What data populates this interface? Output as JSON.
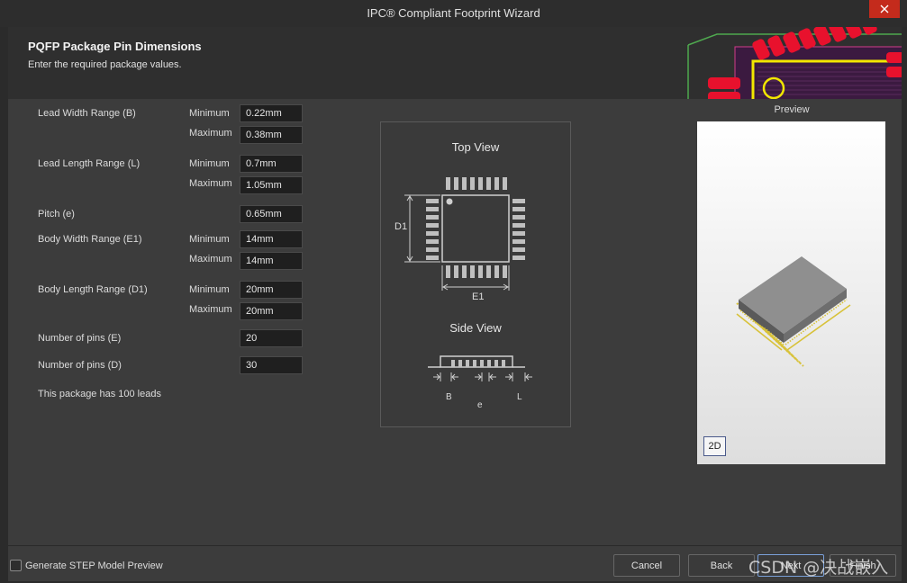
{
  "window": {
    "title": "IPC® Compliant Footprint Wizard"
  },
  "header": {
    "title": "PQFP Package Pin Dimensions",
    "subtitle": "Enter the required package values."
  },
  "form": {
    "lead_width": {
      "label": "Lead Width Range (B)",
      "min_label": "Minimum",
      "min": "0.22mm",
      "max_label": "Maximum",
      "max": "0.38mm"
    },
    "lead_length": {
      "label": "Lead Length Range (L)",
      "min_label": "Minimum",
      "min": "0.7mm",
      "max_label": "Maximum",
      "max": "1.05mm"
    },
    "pitch": {
      "label": "Pitch (e)",
      "value": "0.65mm"
    },
    "body_width": {
      "label": "Body Width Range (E1)",
      "min_label": "Minimum",
      "min": "14mm",
      "max_label": "Maximum",
      "max": "14mm"
    },
    "body_length": {
      "label": "Body Length Range (D1)",
      "min_label": "Minimum",
      "min": "20mm",
      "max_label": "Maximum",
      "max": "20mm"
    },
    "pins_e": {
      "label": "Number of pins (E)",
      "value": "20"
    },
    "pins_d": {
      "label": "Number of pins (D)",
      "value": "30"
    },
    "lead_count_text": "This package has 100 leads"
  },
  "diagram": {
    "top_view": "Top View",
    "side_view": "Side View",
    "d1": "D1",
    "e1": "E1",
    "b": "B",
    "e": "e",
    "l": "L"
  },
  "preview": {
    "label": "Preview",
    "mode_button": "2D"
  },
  "footer": {
    "step_checkbox_label": "Generate STEP Model Preview",
    "step_checked": false,
    "cancel": "Cancel",
    "back": "Back",
    "next": "Next",
    "finish": "Finish"
  },
  "watermark": "CSDN @决战嵌入式",
  "colors": {
    "accent": "#c42b1c",
    "pad": "#e8112d",
    "body": "#3c3c3c"
  }
}
